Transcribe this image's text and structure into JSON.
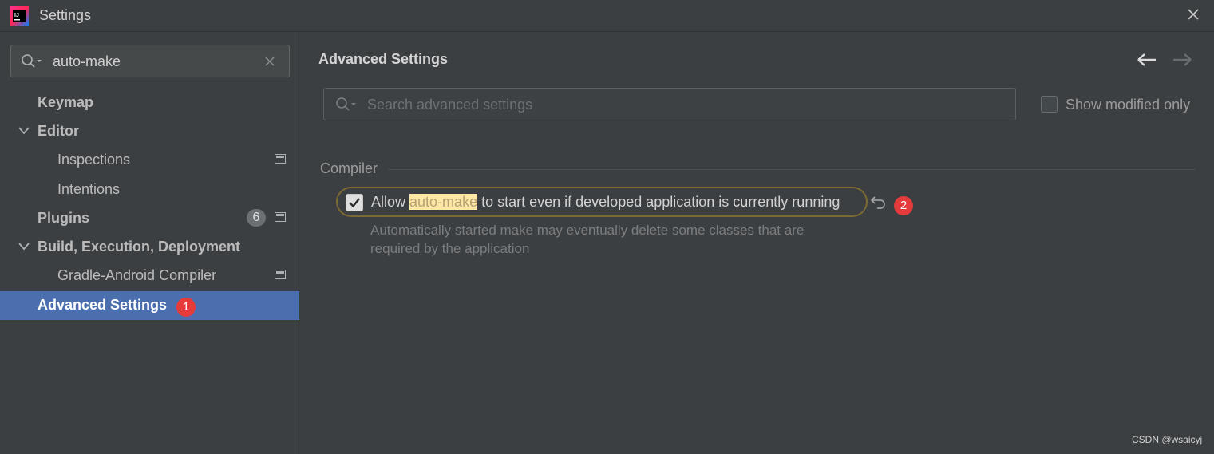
{
  "window": {
    "title": "Settings",
    "close_icon": "close-icon",
    "app_icon": "intellij-logo"
  },
  "sidebar": {
    "search": {
      "value": "auto-make",
      "placeholder": ""
    },
    "items": [
      {
        "label": "Keymap",
        "bold": true
      },
      {
        "label": "Editor",
        "bold": true,
        "expanded": true
      },
      {
        "label": "Inspections",
        "bold": false
      },
      {
        "label": "Intentions",
        "bold": false
      },
      {
        "label": "Plugins",
        "bold": true,
        "badge": "6"
      },
      {
        "label": "Build, Execution, Deployment",
        "bold": true,
        "expanded": true
      },
      {
        "label": "Gradle-Android Compiler",
        "bold": false
      },
      {
        "label": "Advanced Settings",
        "bold": true,
        "selected": true,
        "annotation": "1"
      }
    ]
  },
  "main": {
    "title": "Advanced Settings",
    "search_placeholder": "Search advanced settings",
    "show_modified_label": "Show modified only",
    "group_title": "Compiler",
    "option": {
      "checked": true,
      "text_before": "Allow",
      "highlight": "auto-make",
      "text_after": "to start even if developed application is currently running",
      "description": "Automatically started make may eventually delete some classes that are required by the application",
      "annotation": "2"
    }
  },
  "watermark": "CSDN @wsaicyj",
  "colors": {
    "background": "#3c3f41",
    "selection": "#4b6eaf",
    "highlight": "#fce8a4",
    "annotation": "#e63b3b"
  }
}
